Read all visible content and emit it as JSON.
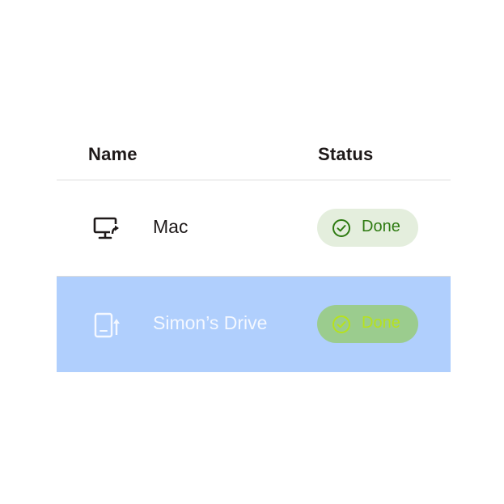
{
  "table": {
    "columns": {
      "name": "Name",
      "status": "Status"
    },
    "rows": [
      {
        "name": "Mac",
        "icon": "computer-upload-icon",
        "status": "Done",
        "selected": false
      },
      {
        "name": "Simon’s Drive",
        "icon": "external-drive-upload-icon",
        "status": "Done",
        "selected": true
      }
    ]
  },
  "colors": {
    "selected_row": "#b0cffd",
    "done_pill": "#e4eedd",
    "done_text": "#2d7a10",
    "text": "#1e1919"
  }
}
